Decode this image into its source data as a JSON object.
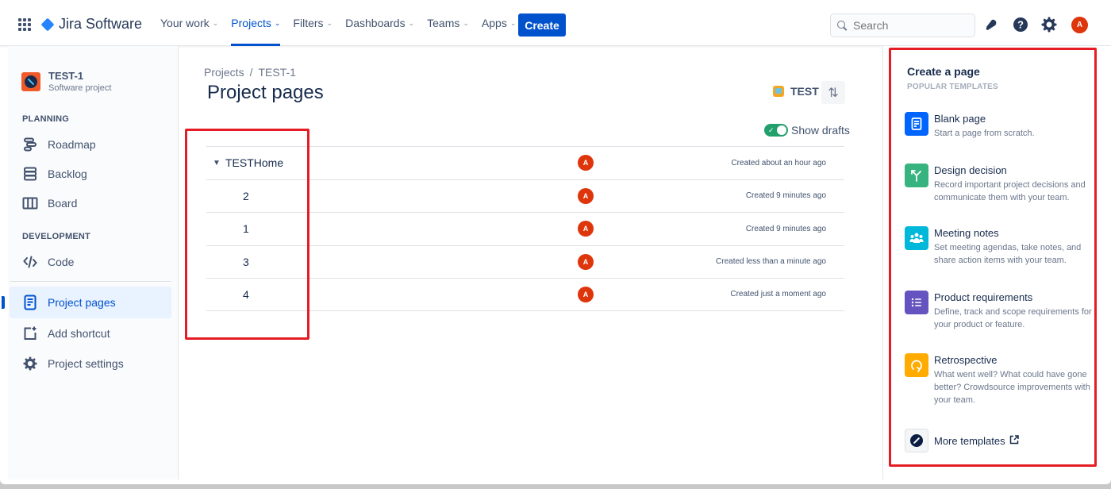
{
  "topnav": {
    "product_name": "Jira Software",
    "items": [
      {
        "label": "Your work",
        "active": false
      },
      {
        "label": "Projects",
        "active": true
      },
      {
        "label": "Filters",
        "active": false
      },
      {
        "label": "Dashboards",
        "active": false
      },
      {
        "label": "Teams",
        "active": false
      },
      {
        "label": "Apps",
        "active": false
      }
    ],
    "create_label": "Create",
    "search_placeholder": "Search",
    "icons": [
      "notifications-icon",
      "help-icon",
      "settings-icon"
    ],
    "user_initial": "A"
  },
  "sidebar": {
    "project_name": "TEST-1",
    "project_type": "Software project",
    "sections": [
      {
        "label": "PLANNING"
      },
      {
        "label": "DEVELOPMENT"
      }
    ],
    "items": [
      {
        "label": "Roadmap",
        "icon": "roadmap-icon"
      },
      {
        "label": "Backlog",
        "icon": "backlog-icon"
      },
      {
        "label": "Board",
        "icon": "board-icon"
      },
      {
        "label": "Code",
        "icon": "code-icon"
      },
      {
        "label": "Project pages",
        "icon": "page-icon",
        "selected": true
      },
      {
        "label": "Add shortcut",
        "icon": "add-shortcut-icon"
      },
      {
        "label": "Project settings",
        "icon": "settings-icon"
      }
    ]
  },
  "main": {
    "breadcrumb": [
      "Projects",
      "TEST-1"
    ],
    "breadcrumb_sep": "/",
    "title": "Project pages",
    "space_label": "TEST",
    "show_drafts_label": "Show drafts",
    "show_drafts_on": true,
    "pages": [
      {
        "title": "TESTHome",
        "author_initial": "A",
        "created": "Created about an hour ago",
        "expanded": true,
        "level": 0
      },
      {
        "title": "2",
        "author_initial": "A",
        "created": "Created 9 minutes ago",
        "level": 1
      },
      {
        "title": "1",
        "author_initial": "A",
        "created": "Created 9 minutes ago",
        "level": 1
      },
      {
        "title": "3",
        "author_initial": "A",
        "created": "Created less than a minute ago",
        "level": 1
      },
      {
        "title": "4",
        "author_initial": "A",
        "created": "Created just a moment ago",
        "level": 1
      }
    ]
  },
  "create_panel": {
    "title": "Create a page",
    "subtitle": "POPULAR TEMPLATES",
    "templates": [
      {
        "name": "Blank page",
        "desc": "Start a page from scratch.",
        "color": "#0065ff",
        "icon": "blank-page-icon"
      },
      {
        "name": "Design decision",
        "desc": "Record important project decisions and communicate them with your team.",
        "color": "#36b37e",
        "icon": "decision-icon"
      },
      {
        "name": "Meeting notes",
        "desc": "Set meeting agendas, take notes, and share action items with your team.",
        "color": "#00b8d9",
        "icon": "people-icon"
      },
      {
        "name": "Product requirements",
        "desc": "Define, track and scope requirements for your product or feature.",
        "color": "#6554c0",
        "icon": "list-icon"
      },
      {
        "name": "Retrospective",
        "desc": "What went well? What could have gone better? Crowdsource improvements with your team.",
        "color": "#ffab00",
        "icon": "retro-icon"
      }
    ],
    "more_label": "More templates"
  },
  "colors": {
    "accent": "#0052cc",
    "avatar": "#de350b",
    "toggle_on": "#22a06b",
    "highlight": "#e51c23"
  }
}
